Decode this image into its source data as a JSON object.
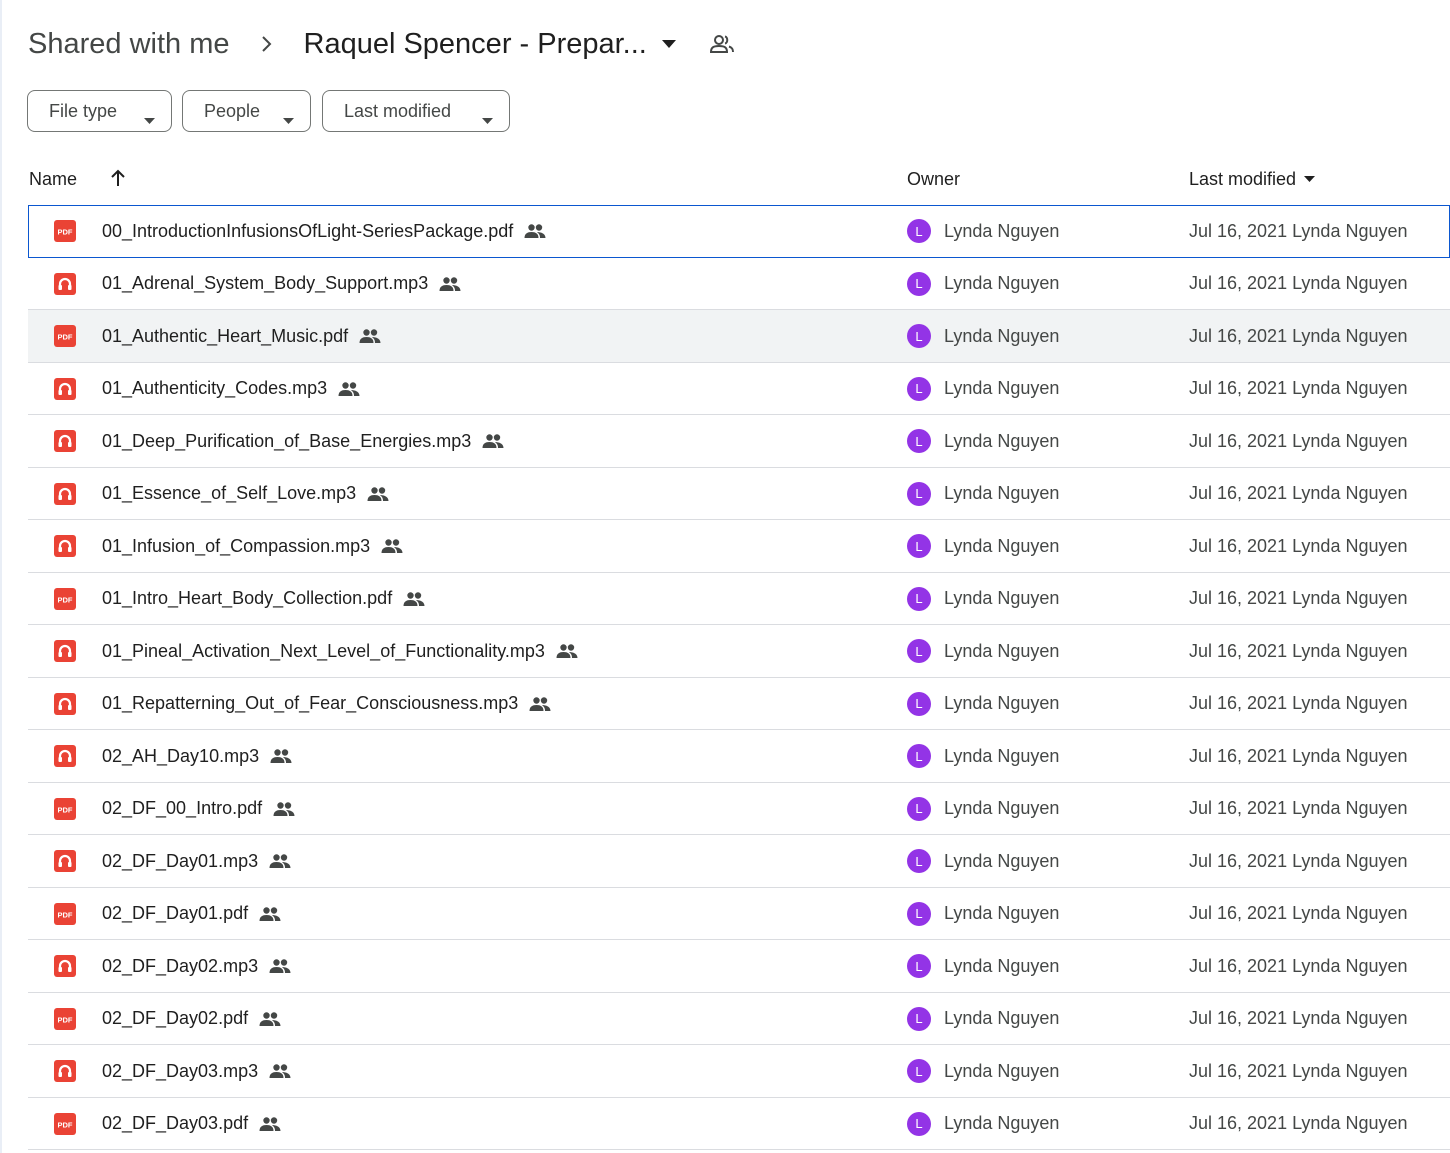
{
  "breadcrumb": {
    "root": "Shared with me",
    "current": "Raquel Spencer - Prepar..."
  },
  "filters": {
    "file_type": "File type",
    "people": "People",
    "last_modified": "Last modified"
  },
  "columns": {
    "name": "Name",
    "owner": "Owner",
    "last_modified": "Last modified"
  },
  "colors": {
    "accent": "#0b57d0",
    "avatar": "#9334e6",
    "file_red": "#ea4335"
  },
  "files": [
    {
      "name": "00_IntroductionInfusionsOfLight-SeriesPackage.pdf",
      "type": "pdf",
      "owner": "Lynda Nguyen",
      "owner_initial": "L",
      "modified": "Jul 16, 2021 Lynda Nguyen"
    },
    {
      "name": "01_Adrenal_System_Body_Support.mp3",
      "type": "audio",
      "owner": "Lynda Nguyen",
      "owner_initial": "L",
      "modified": "Jul 16, 2021 Lynda Nguyen"
    },
    {
      "name": "01_Authentic_Heart_Music.pdf",
      "type": "pdf",
      "owner": "Lynda Nguyen",
      "owner_initial": "L",
      "modified": "Jul 16, 2021 Lynda Nguyen"
    },
    {
      "name": "01_Authenticity_Codes.mp3",
      "type": "audio",
      "owner": "Lynda Nguyen",
      "owner_initial": "L",
      "modified": "Jul 16, 2021 Lynda Nguyen"
    },
    {
      "name": "01_Deep_Purification_of_Base_Energies.mp3",
      "type": "audio",
      "owner": "Lynda Nguyen",
      "owner_initial": "L",
      "modified": "Jul 16, 2021 Lynda Nguyen"
    },
    {
      "name": "01_Essence_of_Self_Love.mp3",
      "type": "audio",
      "owner": "Lynda Nguyen",
      "owner_initial": "L",
      "modified": "Jul 16, 2021 Lynda Nguyen"
    },
    {
      "name": "01_Infusion_of_Compassion.mp3",
      "type": "audio",
      "owner": "Lynda Nguyen",
      "owner_initial": "L",
      "modified": "Jul 16, 2021 Lynda Nguyen"
    },
    {
      "name": "01_Intro_Heart_Body_Collection.pdf",
      "type": "pdf",
      "owner": "Lynda Nguyen",
      "owner_initial": "L",
      "modified": "Jul 16, 2021 Lynda Nguyen"
    },
    {
      "name": "01_Pineal_Activation_Next_Level_of_Functionality.mp3",
      "type": "audio",
      "owner": "Lynda Nguyen",
      "owner_initial": "L",
      "modified": "Jul 16, 2021 Lynda Nguyen"
    },
    {
      "name": "01_Repatterning_Out_of_Fear_Consciousness.mp3",
      "type": "audio",
      "owner": "Lynda Nguyen",
      "owner_initial": "L",
      "modified": "Jul 16, 2021 Lynda Nguyen"
    },
    {
      "name": "02_AH_Day10.mp3",
      "type": "audio",
      "owner": "Lynda Nguyen",
      "owner_initial": "L",
      "modified": "Jul 16, 2021 Lynda Nguyen"
    },
    {
      "name": "02_DF_00_Intro.pdf",
      "type": "pdf",
      "owner": "Lynda Nguyen",
      "owner_initial": "L",
      "modified": "Jul 16, 2021 Lynda Nguyen"
    },
    {
      "name": "02_DF_Day01.mp3",
      "type": "audio",
      "owner": "Lynda Nguyen",
      "owner_initial": "L",
      "modified": "Jul 16, 2021 Lynda Nguyen"
    },
    {
      "name": "02_DF_Day01.pdf",
      "type": "pdf",
      "owner": "Lynda Nguyen",
      "owner_initial": "L",
      "modified": "Jul 16, 2021 Lynda Nguyen"
    },
    {
      "name": "02_DF_Day02.mp3",
      "type": "audio",
      "owner": "Lynda Nguyen",
      "owner_initial": "L",
      "modified": "Jul 16, 2021 Lynda Nguyen"
    },
    {
      "name": "02_DF_Day02.pdf",
      "type": "pdf",
      "owner": "Lynda Nguyen",
      "owner_initial": "L",
      "modified": "Jul 16, 2021 Lynda Nguyen"
    },
    {
      "name": "02_DF_Day03.mp3",
      "type": "audio",
      "owner": "Lynda Nguyen",
      "owner_initial": "L",
      "modified": "Jul 16, 2021 Lynda Nguyen"
    },
    {
      "name": "02_DF_Day03.pdf",
      "type": "pdf",
      "owner": "Lynda Nguyen",
      "owner_initial": "L",
      "modified": "Jul 16, 2021 Lynda Nguyen"
    }
  ]
}
